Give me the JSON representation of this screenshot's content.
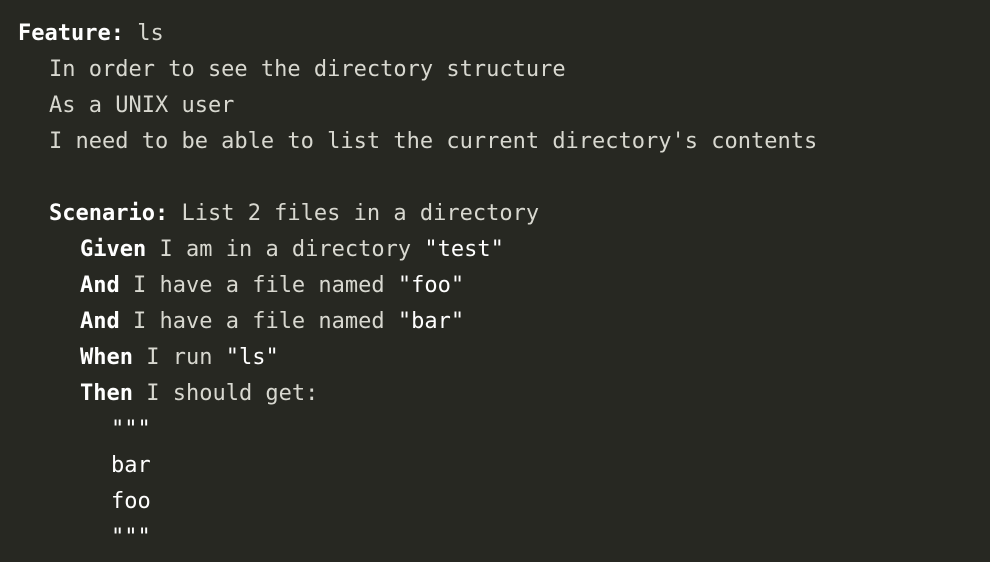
{
  "feature": {
    "keyword": "Feature:",
    "name": "ls",
    "description": [
      "In order to see the directory structure",
      "As a UNIX user",
      "I need to be able to list the current directory's contents"
    ]
  },
  "scenario": {
    "keyword": "Scenario:",
    "name": "List 2 files in a directory",
    "steps": [
      {
        "keyword": "Given",
        "pre": " I am in a directory ",
        "arg": "\"test\"",
        "post": ""
      },
      {
        "keyword": "And",
        "pre": " I have a file named ",
        "arg": "\"foo\"",
        "post": ""
      },
      {
        "keyword": "And",
        "pre": " I have a file named ",
        "arg": "\"bar\"",
        "post": ""
      },
      {
        "keyword": "When",
        "pre": " I run ",
        "arg": "\"ls\"",
        "post": ""
      },
      {
        "keyword": "Then",
        "pre": " I should get:",
        "arg": "",
        "post": ""
      }
    ],
    "docstring": {
      "open": "\"\"\"",
      "lines": [
        "bar",
        "foo"
      ],
      "close": "\"\"\""
    }
  }
}
